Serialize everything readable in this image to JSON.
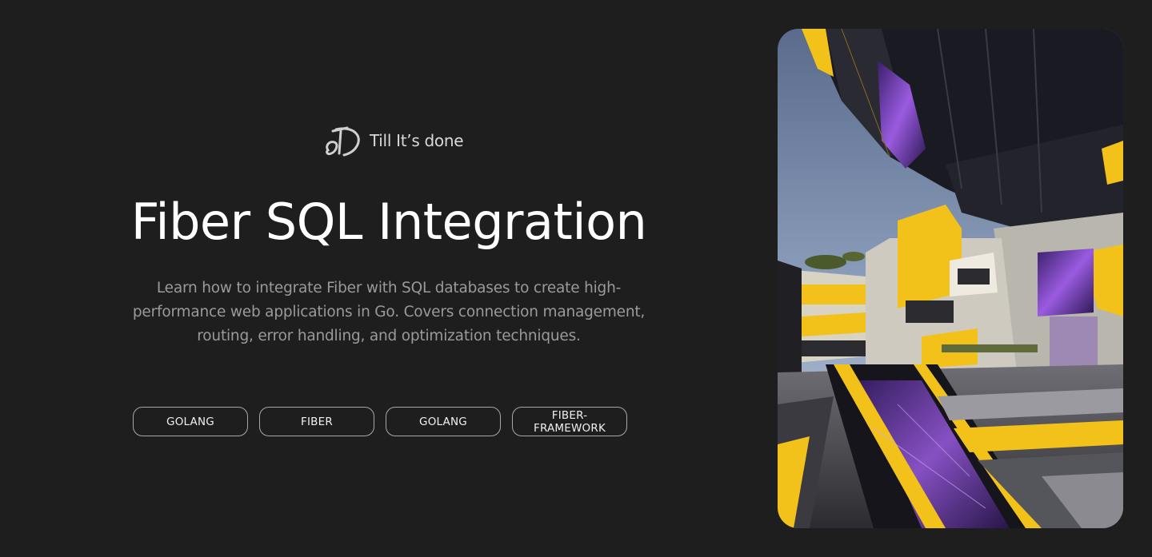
{
  "brand": {
    "name": "Till It’s done",
    "logo_icon": "td-signature-logo-icon"
  },
  "article": {
    "title": "Fiber SQL Integration",
    "description": "Learn how to integrate Fiber with SQL databases to create high-performance web applications in Go. Covers connection management, routing, error handling, and optimization techniques."
  },
  "tags": [
    {
      "label": "GOLANG"
    },
    {
      "label": "FIBER"
    },
    {
      "label": "GOLANG"
    },
    {
      "label": "FIBER-FRAMEWORK"
    }
  ],
  "hero_image": {
    "subject": "futuristic-architecture-illustration",
    "colors": {
      "black": "#16161c",
      "yellow": "#f3c21a",
      "purple": "#7a3fbf",
      "sky": "#7f92b0",
      "concrete": "#b9b6ae"
    }
  },
  "theme": {
    "background": "#1e1e1e",
    "text": "#ffffff",
    "muted_text": "#9a9a9a",
    "border": "#a8a8a8"
  }
}
